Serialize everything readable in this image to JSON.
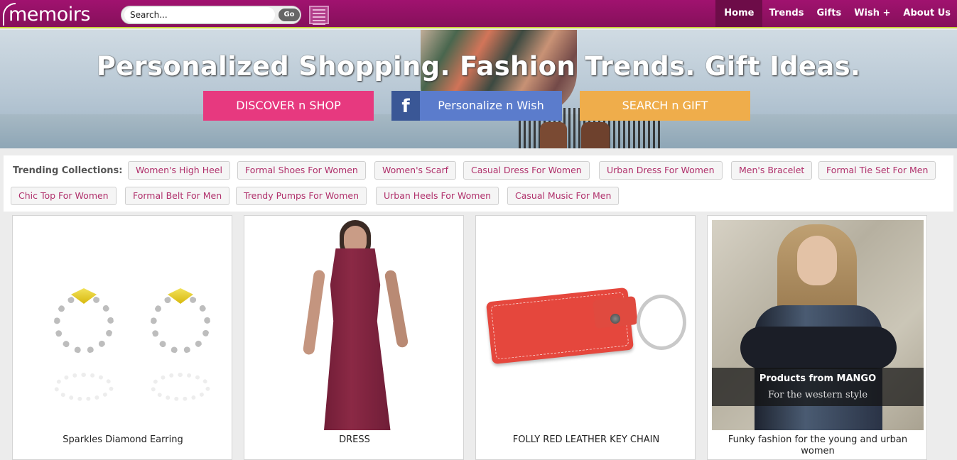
{
  "brand": {
    "logo_text": "memoirs"
  },
  "search": {
    "placeholder": "Search...",
    "go_label": "Go"
  },
  "nav": {
    "items": [
      {
        "label": "Home",
        "active": true
      },
      {
        "label": "Trends"
      },
      {
        "label": "Gifts"
      },
      {
        "label": "Wish +"
      },
      {
        "label": "About Us"
      }
    ]
  },
  "hero": {
    "title": "Personalized Shopping. Fashion Trends. Gift Ideas.",
    "buttons": {
      "discover": "DISCOVER n SHOP",
      "wish_icon": "f",
      "wish": "Personalize n Wish",
      "gift": "SEARCH n GIFT"
    }
  },
  "trending": {
    "label": "Trending Collections:",
    "chips": [
      "Women's High Heel",
      "Formal Shoes For Women",
      "Women's Scarf",
      "Casual Dress For Women",
      "Urban Dress For Women",
      "Men's Bracelet",
      "Formal Tie Set For Men",
      "Chic Top For Women",
      "Formal Belt For Men",
      "Trendy Pumps For Women",
      "Urban Heels For Women",
      "Casual Music For Men"
    ]
  },
  "products": [
    {
      "title": "Sparkles Diamond Earring"
    },
    {
      "title": "DRESS"
    },
    {
      "title": "FOLLY RED LEATHER KEY CHAIN"
    },
    {
      "title": "Funky fashion for the young and urban women",
      "overlay_title": "Products from MANGO",
      "overlay_subtitle": "For the western style"
    }
  ],
  "colors": {
    "topbar": "#97116a",
    "accent_line": "#c9d13a",
    "discover_btn": "#e7397f",
    "wish_btn": "#5b7ccc",
    "gift_btn": "#efad4b",
    "chip_text": "#b0306b"
  }
}
